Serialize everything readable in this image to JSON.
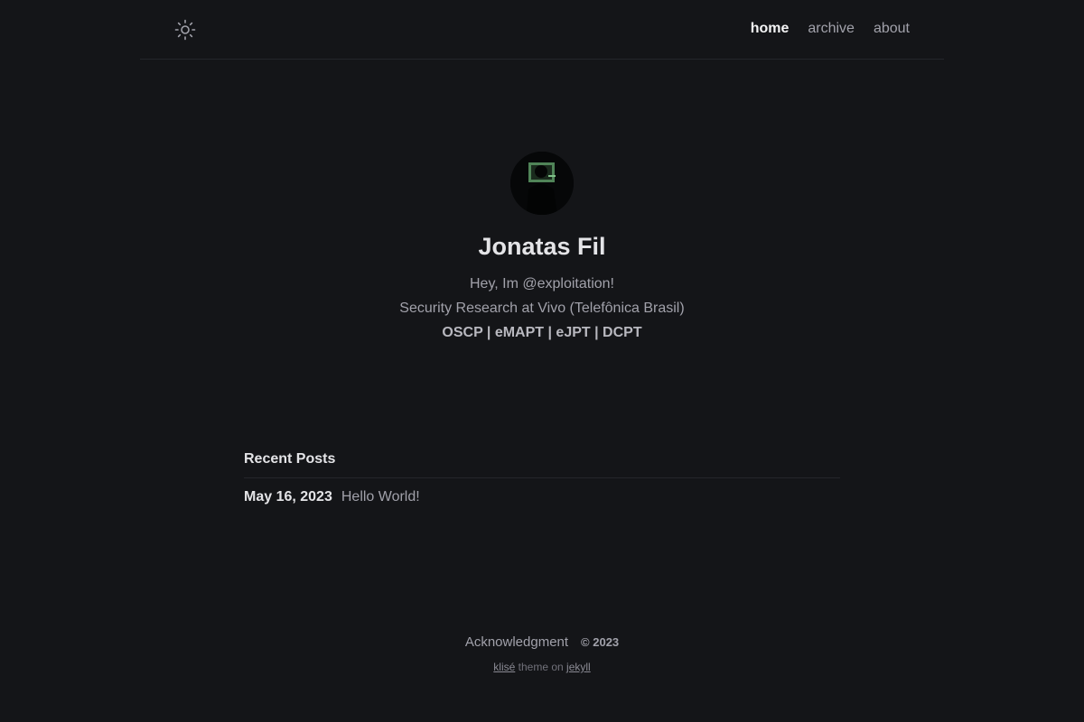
{
  "nav": {
    "theme_icon": "sun-icon",
    "links": [
      {
        "label": "home",
        "active": true
      },
      {
        "label": "archive",
        "active": false
      },
      {
        "label": "about",
        "active": false
      }
    ]
  },
  "profile": {
    "name": "Jonatas Fil",
    "bio": [
      "Hey, Im @exploitation!",
      "Security Research at Vivo (Telefônica Brasil)"
    ],
    "certs": "OSCP | eMAPT | eJPT | DCPT"
  },
  "recent_posts": {
    "title": "Recent Posts",
    "posts": [
      {
        "date": "May 16, 2023",
        "title": "Hello World!"
      }
    ]
  },
  "footer": {
    "acknowledgment": "Acknowledgment",
    "copyright": "© 2023",
    "theme_link": "klisé",
    "theme_text": "theme on",
    "engine_link": "jekyll"
  },
  "colors": {
    "background": "#141518",
    "text_primary": "#e4e4e7",
    "text_secondary": "#a1a1aa"
  }
}
